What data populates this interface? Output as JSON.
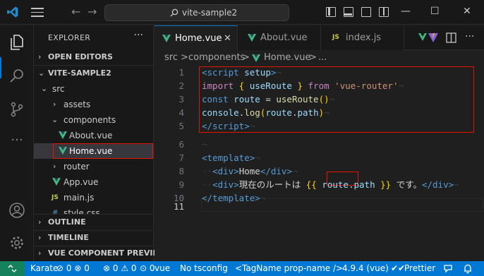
{
  "titlebar": {
    "search_text": "vite-sample2",
    "icons": [
      "vscode-logo-icon",
      "menu-icon",
      "back-arrow-icon",
      "forward-arrow-icon",
      "search-icon",
      "toggle-sidebar-icon",
      "toggle-panel-icon",
      "toggle-secondary-sidebar-icon",
      "customize-layout-icon",
      "minimize-icon",
      "maximize-icon",
      "close-icon"
    ],
    "window_controls": {
      "minimize": "—",
      "maximize": "☐",
      "close": "✕"
    }
  },
  "activity_bar": {
    "items": [
      "explorer-icon",
      "search-icon",
      "source-control-icon",
      "more-icon",
      "account-icon",
      "manage-gear-icon"
    ],
    "active": "explorer-icon",
    "more_label": "···"
  },
  "sidebar": {
    "title": "EXPLORER",
    "more": "···",
    "sections": {
      "open_editors": "OPEN EDITORS",
      "project": "VITE-SAMPLE2",
      "outline": "OUTLINE",
      "timeline": "TIMELINE",
      "vue_preview": "VUE COMPONENT PREVIEW"
    },
    "tree": [
      {
        "label": "src",
        "kind": "folder-open"
      },
      {
        "label": "assets",
        "kind": "folder"
      },
      {
        "label": "components",
        "kind": "folder-open"
      },
      {
        "label": "About.vue",
        "kind": "vue"
      },
      {
        "label": "Home.vue",
        "kind": "vue",
        "selected": true
      },
      {
        "label": "router",
        "kind": "folder"
      },
      {
        "label": "App.vue",
        "kind": "vue"
      },
      {
        "label": "main.js",
        "kind": "js"
      },
      {
        "label": "style.css",
        "kind": "css"
      }
    ],
    "js_badge": "JS",
    "css_badge": "#"
  },
  "tabs": [
    {
      "label": "Home.vue",
      "active": true,
      "close": "✕"
    },
    {
      "label": "About.vue",
      "active": false
    },
    {
      "label": "index.js",
      "active": false,
      "badge": "JS"
    }
  ],
  "breadcrumb": {
    "parts": [
      "src",
      "components",
      "Home.vue",
      "..."
    ],
    "sep": ">"
  },
  "editor": {
    "line_numbers": [
      "1",
      "2",
      "3",
      "4",
      "5",
      "6",
      "7",
      "8",
      "9",
      "10",
      "11"
    ],
    "current_line": "11",
    "lines": {
      "l1": {
        "a": "<script",
        "b": " setup",
        "c": ">",
        "ws": "¬"
      },
      "l2": {
        "a": "import",
        "b": " { ",
        "c": "useRoute",
        "d": " } ",
        "e": "from",
        "f": " ",
        "g": "'vue-router'",
        "ws": "¬"
      },
      "l3": {
        "a": "const",
        "b": " route",
        "c": " = ",
        "d": "useRoute",
        "e": "()",
        "ws": "¬"
      },
      "l4": {
        "a": "console",
        "b": ".",
        "c": "log",
        "d": "(",
        "e": "route",
        "f": ".",
        "g": "path",
        "h": ")",
        "ws": "¬"
      },
      "l5": {
        "a": "</script",
        "b": ">",
        "ws": "¬"
      },
      "l6": {
        "ws": "¬"
      },
      "l7": {
        "a": "<template>",
        "ws": "¬"
      },
      "l8": {
        "dots": "··",
        "a": "<div>",
        "b": "Home",
        "c": "</div>",
        "ws": "¬"
      },
      "l9": {
        "dots": "··",
        "a": "<div>",
        "b": "現在のルートは ",
        "c": "{{",
        "d": " ",
        "e": "route",
        "f": ".",
        "g": "path",
        "h": " ",
        "i": "}}",
        "j": " です。",
        "k": "</div>",
        "ws": "¬"
      },
      "l10": {
        "a": "</template>",
        "ws": "¬"
      },
      "l11": {
        "a": ""
      }
    }
  },
  "statusbar": {
    "remote_icon": "remote-icon",
    "karate": "Karate",
    "karate_counts": "⊘ 0 ⊗ 0",
    "problems": "⊗ 0 ⚠ 0",
    "ports": "⊙ 0",
    "language": "vue",
    "tsconfig": "No tsconfig",
    "tagname": "<TagName prop-name />",
    "version": "4.9.4 (vue)",
    "prettier": "Prettier",
    "prettier_check": "✔✔",
    "feedback_icon": "feedback-icon",
    "bell_icon": "bell-icon"
  },
  "colors": {
    "accent": "#0078d4",
    "highlight_box": "#e51400",
    "remote": "#16825d",
    "vue_green": "#41b883"
  }
}
